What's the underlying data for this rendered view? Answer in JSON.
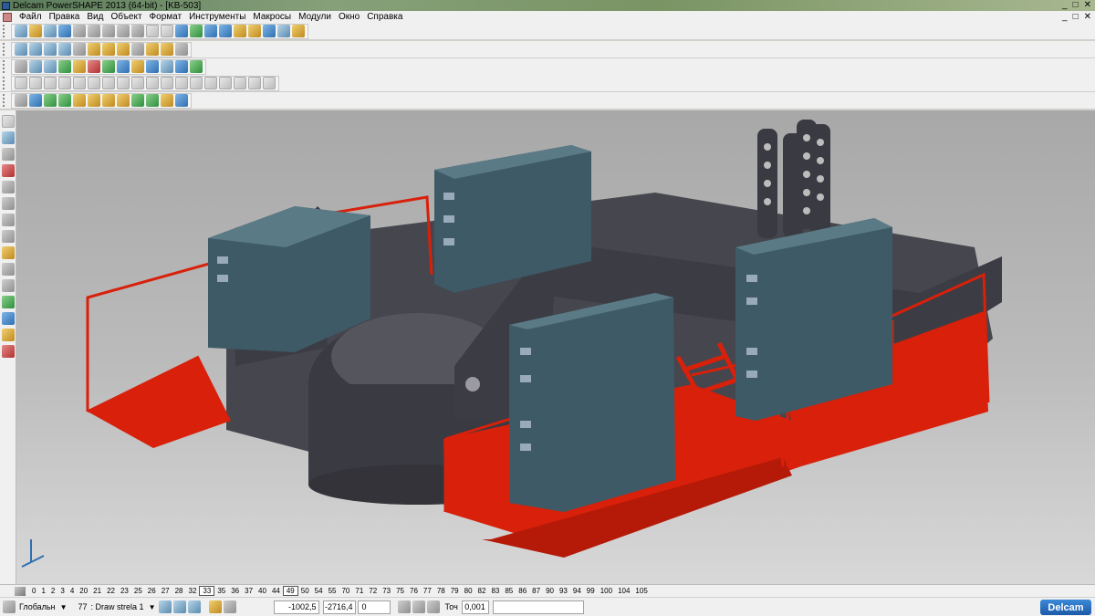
{
  "window": {
    "title": "Delcam PowerSHAPE 2013 (64-bit) - [KB-503]",
    "min": "_",
    "max": "□",
    "close": "✕"
  },
  "menu": {
    "items": [
      "Файл",
      "Правка",
      "Вид",
      "Объект",
      "Формат",
      "Инструменты",
      "Макросы",
      "Модули",
      "Окно",
      "Справка"
    ],
    "doc_min": "_",
    "doc_max": "□",
    "doc_close": "✕"
  },
  "levels": {
    "items": [
      "0",
      "1",
      "2",
      "3",
      "4",
      "20",
      "21",
      "22",
      "23",
      "25",
      "26",
      "27",
      "28",
      "32",
      "33",
      "35",
      "36",
      "37",
      "40",
      "44",
      "49",
      "50",
      "54",
      "55",
      "70",
      "71",
      "72",
      "73",
      "75",
      "76",
      "77",
      "78",
      "79",
      "80",
      "82",
      "83",
      "85",
      "86",
      "87",
      "90",
      "93",
      "94",
      "99",
      "100",
      "104",
      "105"
    ],
    "highlighted": [
      "33",
      "49"
    ]
  },
  "status": {
    "workplane": "Глобальн",
    "level_num": "77",
    "level_name": ": Draw strela 1",
    "x": "-1002,5",
    "y": "-2716,4",
    "z": "0",
    "tolerance_label": "Точ",
    "tolerance": "0,001",
    "logo": "Delcam"
  },
  "colors": {
    "platform": "#d8200a",
    "cabinet": "#3d5a66",
    "frame": "#4a4a52"
  }
}
